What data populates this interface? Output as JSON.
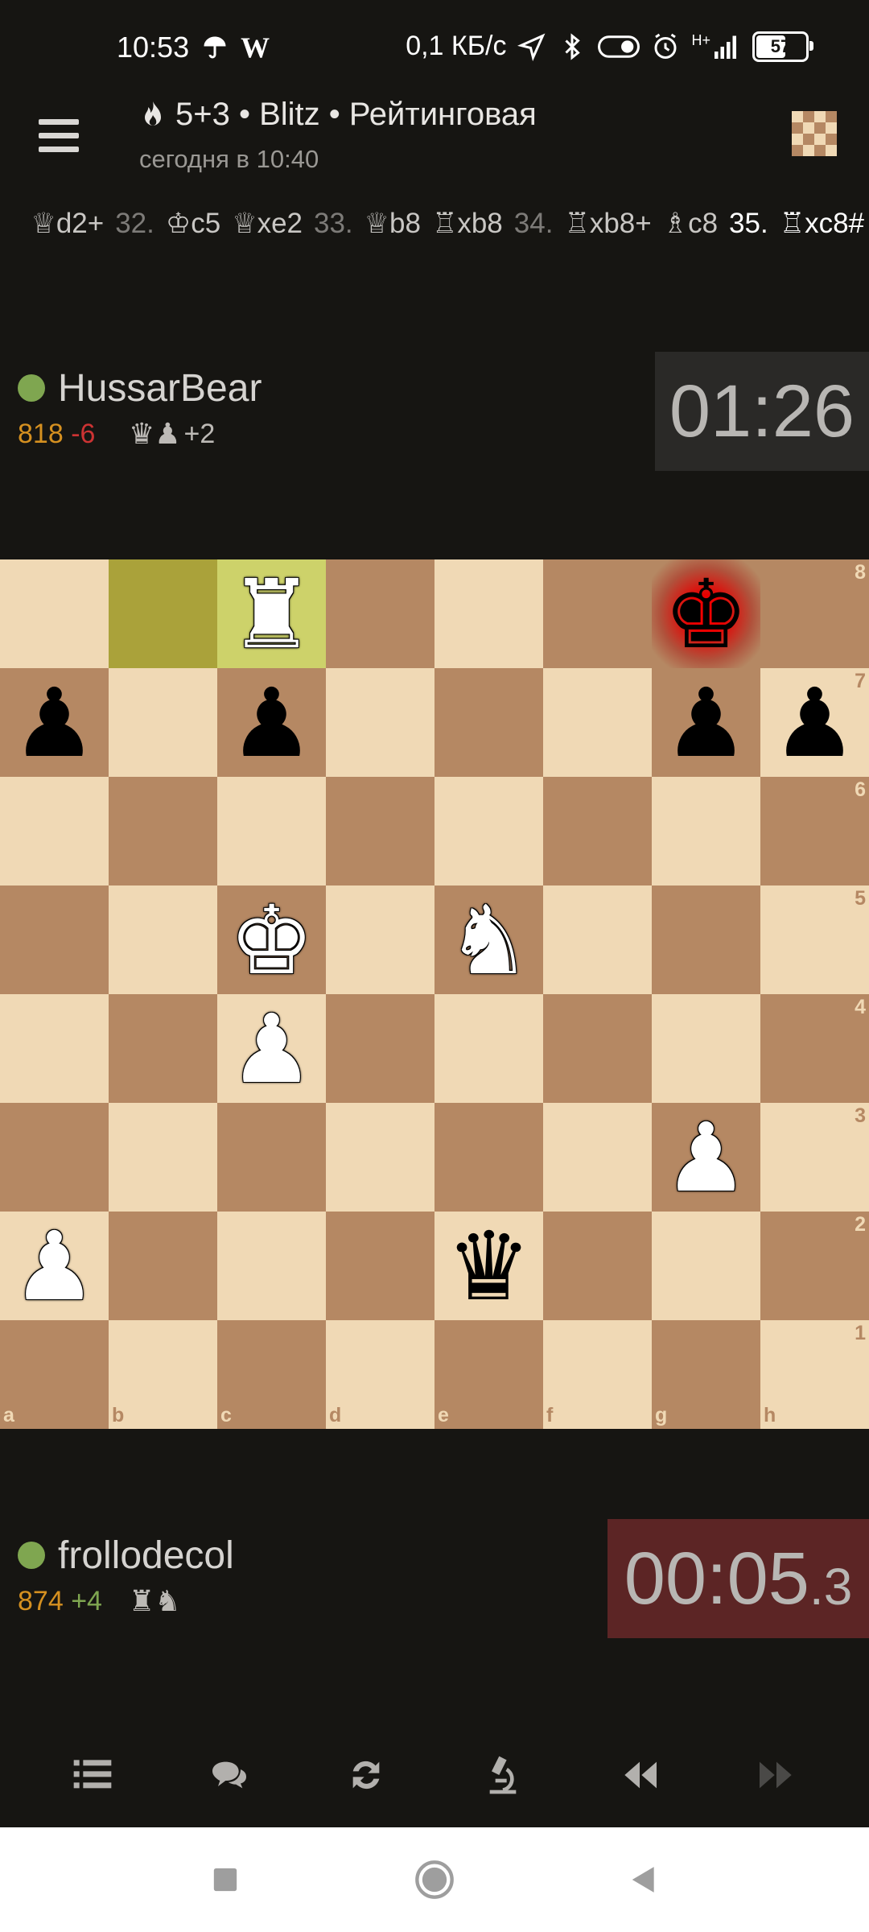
{
  "status_bar": {
    "time": "10:53",
    "app_glyph": "W",
    "net_speed": "0,1 КБ/с",
    "network_type": "H+",
    "battery": "57"
  },
  "header": {
    "title": "5+3 • Blitz • Рейтинговая",
    "subtitle": "сегодня в 10:40"
  },
  "moves": [
    {
      "type": "san",
      "text": "♕d2+"
    },
    {
      "type": "num",
      "text": "32."
    },
    {
      "type": "san",
      "text": "♔c5"
    },
    {
      "type": "san",
      "text": "♕xe2"
    },
    {
      "type": "num",
      "text": "33."
    },
    {
      "type": "san",
      "text": "♕b8"
    },
    {
      "type": "san",
      "text": "♖xb8"
    },
    {
      "type": "num",
      "text": "34."
    },
    {
      "type": "san",
      "text": "♖xb8+"
    },
    {
      "type": "san",
      "text": "♗c8"
    },
    {
      "type": "num_cur",
      "text": "35."
    },
    {
      "type": "cur",
      "text": "♖xc8#"
    }
  ],
  "top_player": {
    "name": "HussarBear",
    "rating": "818",
    "rating_diff": "-6",
    "material": "♛♟",
    "material_score": "+2",
    "clock": "01:26"
  },
  "bottom_player": {
    "name": "frollodecol",
    "rating": "874",
    "rating_diff": "+4",
    "material": "♜♞",
    "clock_main": "00:05",
    "clock_tenths": ".3"
  },
  "board": {
    "ranks": [
      "8",
      "7",
      "6",
      "5",
      "4",
      "3",
      "2",
      "1"
    ],
    "files": [
      "a",
      "b",
      "c",
      "d",
      "e",
      "f",
      "g",
      "h"
    ],
    "last_move_from": "b8",
    "last_move_to": "c8",
    "check_square": "g8",
    "pieces": {
      "c8": {
        "glyph": "♜",
        "color": "white",
        "name": "white-rook"
      },
      "g8": {
        "glyph": "♚",
        "color": "black",
        "name": "black-king"
      },
      "a7": {
        "glyph": "♟",
        "color": "black",
        "name": "black-pawn"
      },
      "c7": {
        "glyph": "♟",
        "color": "black",
        "name": "black-pawn"
      },
      "g7": {
        "glyph": "♟",
        "color": "black",
        "name": "black-pawn"
      },
      "h7": {
        "glyph": "♟",
        "color": "black",
        "name": "black-pawn"
      },
      "c5": {
        "glyph": "♚",
        "color": "white",
        "name": "white-king"
      },
      "e5": {
        "glyph": "♞",
        "color": "white",
        "name": "white-knight"
      },
      "c4": {
        "glyph": "♟",
        "color": "white",
        "name": "white-pawn"
      },
      "g3": {
        "glyph": "♟",
        "color": "white",
        "name": "white-pawn"
      },
      "a2": {
        "glyph": "♟",
        "color": "white",
        "name": "white-pawn"
      },
      "e2": {
        "glyph": "♛",
        "color": "black",
        "name": "black-queen"
      }
    }
  },
  "colors": {
    "background": "#161512",
    "light_square": "#f0d9b5",
    "dark_square": "#b58863",
    "online_dot": "#7fa650",
    "low_time_clock_bg": "#5c2525",
    "clock_bg": "#2a2927"
  },
  "toolbar": [
    "list-icon",
    "chat-icon",
    "flip-board-icon",
    "analysis-microscope-icon",
    "rewind-icon",
    "fast-forward-icon"
  ]
}
